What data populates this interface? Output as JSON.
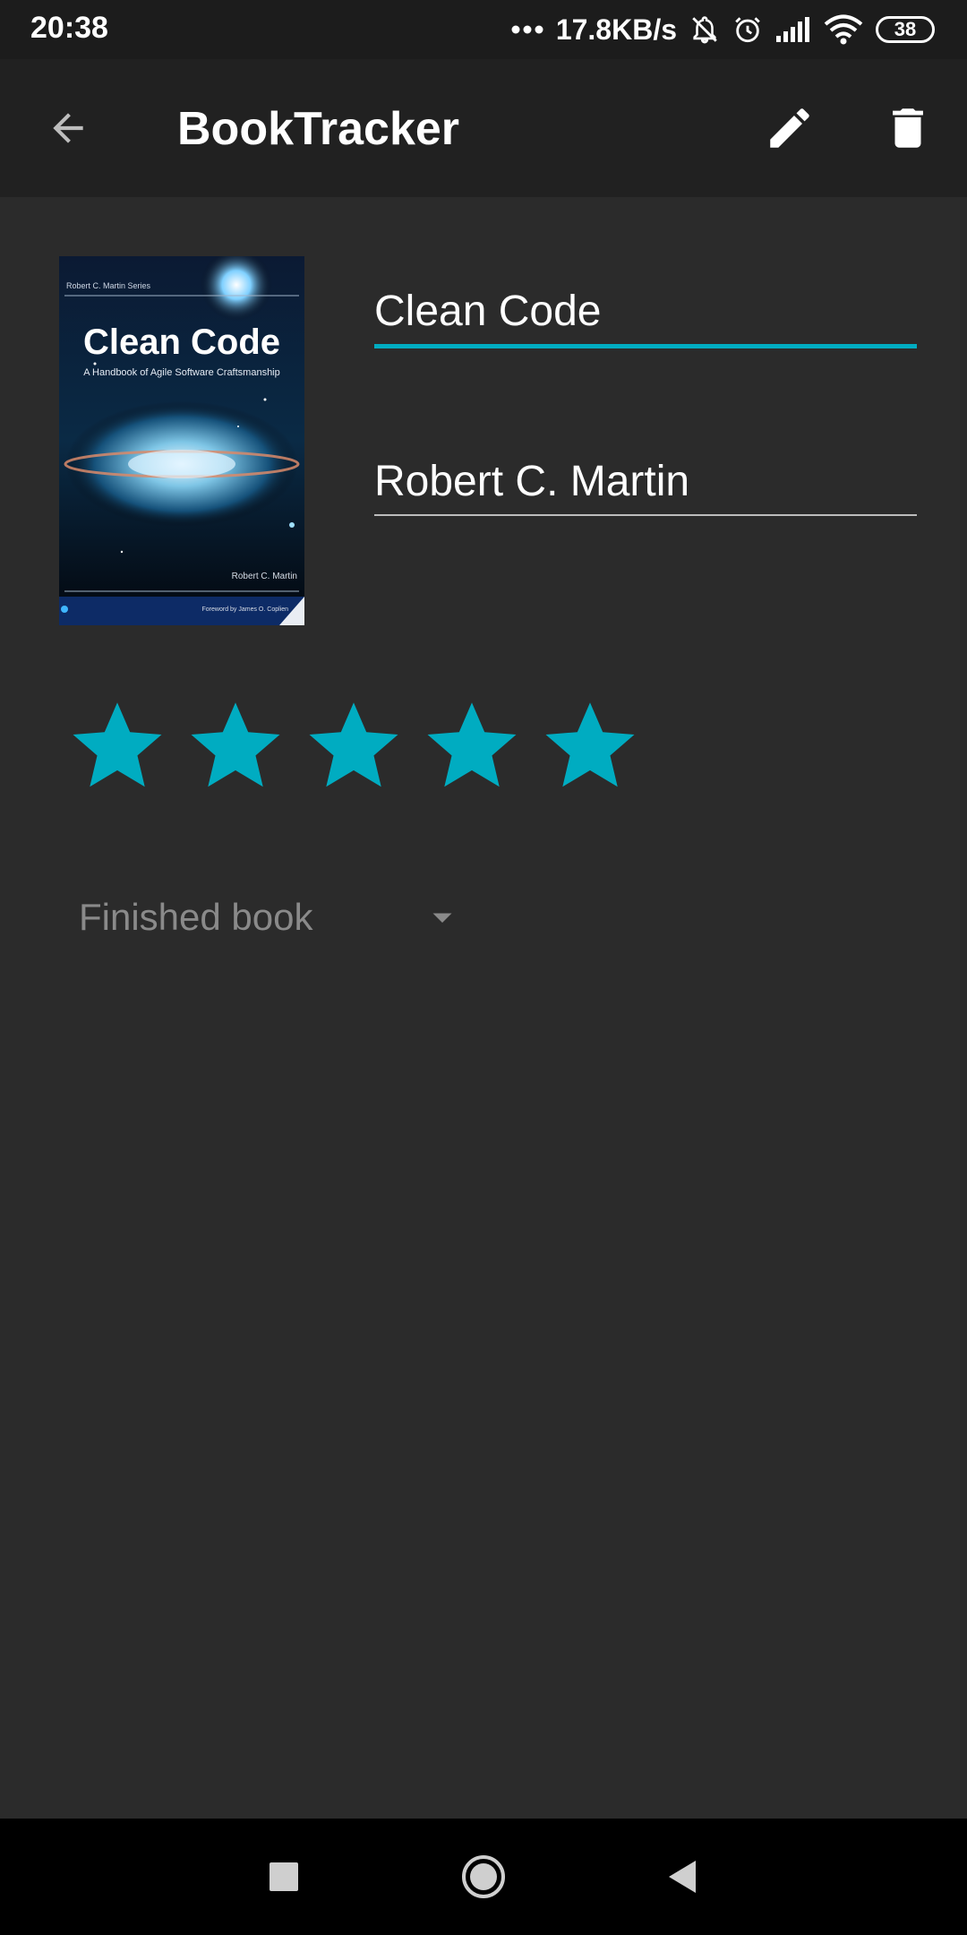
{
  "status_bar": {
    "time": "20:38",
    "network_speed": "17.8KB/s",
    "battery": "38",
    "icons": [
      "dots-icon",
      "bell-off-icon",
      "alarm-icon",
      "signal-icon",
      "wifi-icon",
      "battery-icon"
    ]
  },
  "app_bar": {
    "title": "BookTracker",
    "icons": [
      "arrow-back-icon",
      "pencil-icon",
      "trash-icon"
    ]
  },
  "book": {
    "cover": {
      "series": "Robert C. Martin Series",
      "title": "Clean Code",
      "subtitle": "A Handbook of Agile Software Craftsmanship",
      "author": "Robert C. Martin",
      "foreword": "Foreword by James O. Coplien"
    },
    "title_value": "Clean Code",
    "author_value": "Robert C. Martin",
    "rating": 5,
    "rating_max": 5,
    "status": "Finished book"
  },
  "colors": {
    "accent": "#00acc1",
    "background": "#2b2b2b",
    "app_bar": "#212121",
    "status_bar": "#1c1c1c"
  },
  "nav_bar": {
    "icons": [
      "recents-icon",
      "home-icon",
      "back-icon"
    ]
  }
}
